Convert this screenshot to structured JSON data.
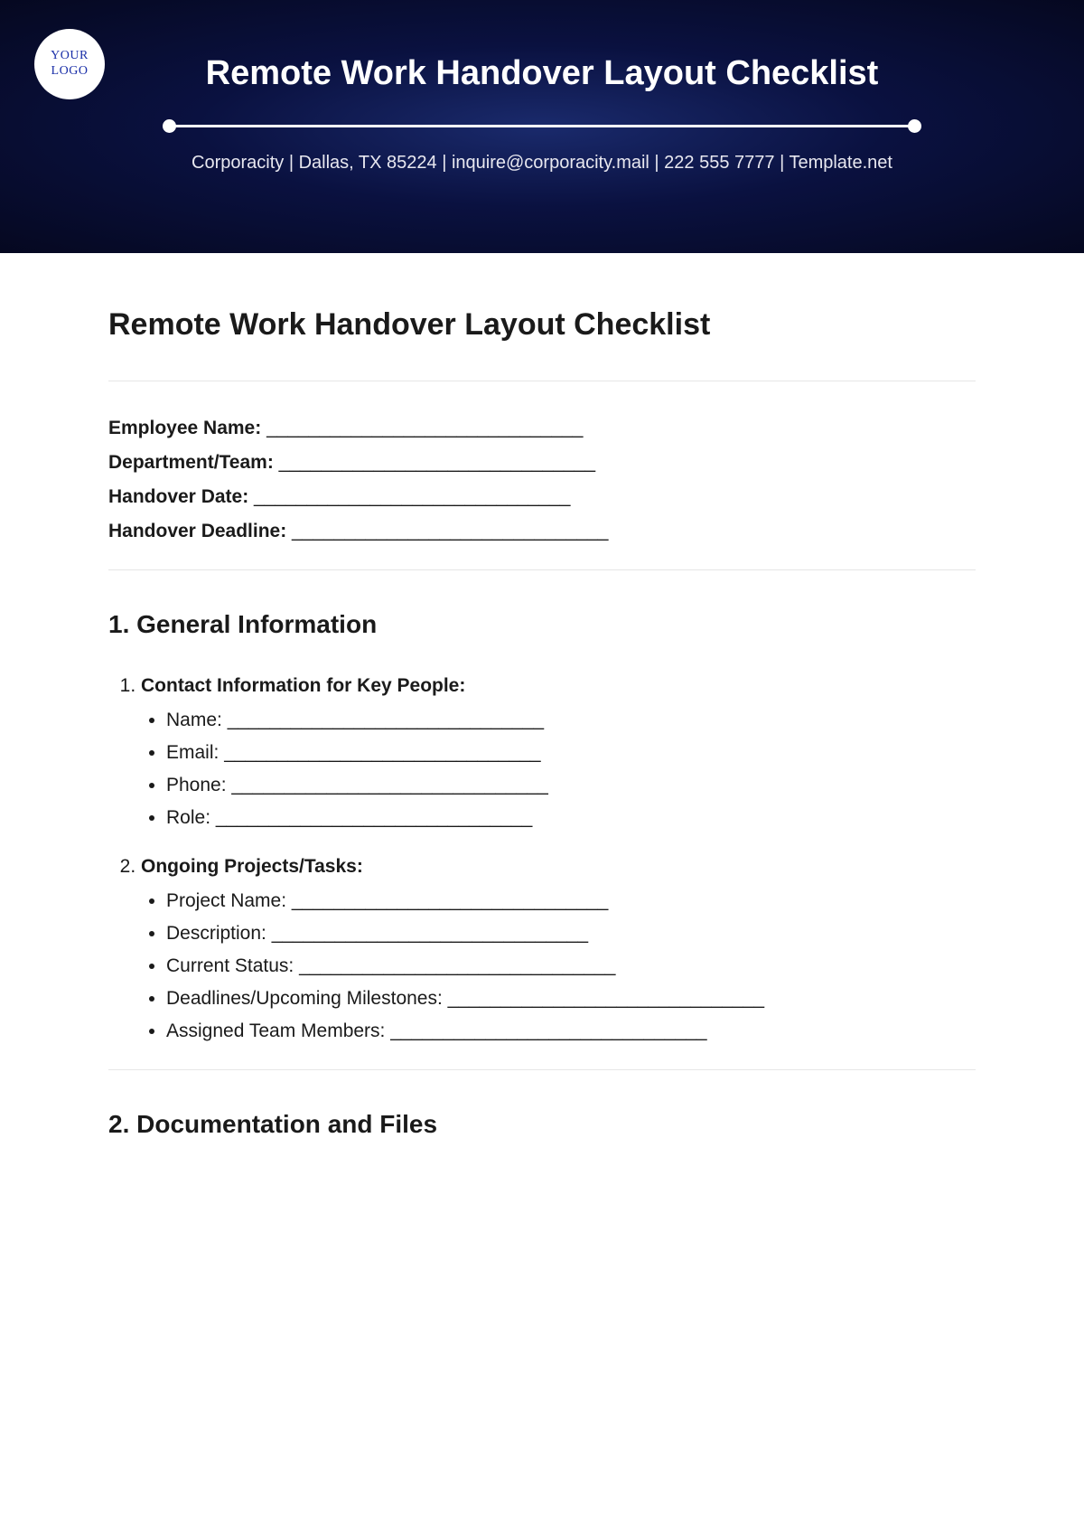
{
  "header": {
    "logo_line1": "YOUR",
    "logo_line2": "LOGO",
    "title": "Remote Work Handover Layout Checklist",
    "subtitle": "Corporacity | Dallas, TX 85224 | inquire@corporacity.mail | 222 555 7777 | Template.net"
  },
  "doc": {
    "title": "Remote Work Handover Layout Checklist",
    "meta": [
      "Employee Name:",
      "Department/Team:",
      "Handover Date:",
      "Handover Deadline:"
    ],
    "blank": " ______________________________",
    "section1": {
      "title": "1. General Information",
      "items": [
        {
          "head": "Contact Information for Key People:",
          "subs": [
            "Name:",
            "Email:",
            "Phone:",
            "Role:"
          ]
        },
        {
          "head": "Ongoing Projects/Tasks:",
          "subs": [
            "Project Name:",
            "Description:",
            "Current Status:",
            "Deadlines/Upcoming Milestones:",
            "Assigned Team Members:"
          ]
        }
      ]
    },
    "section2": {
      "title": "2. Documentation and Files"
    }
  }
}
